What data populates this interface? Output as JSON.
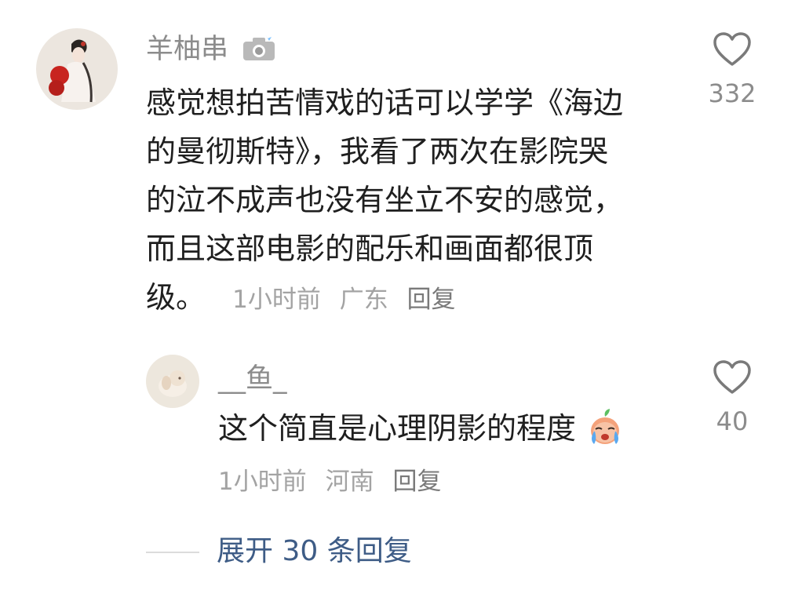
{
  "comments": [
    {
      "username": "羊柚串",
      "badge_icon": "camera-flash-icon",
      "text_lines": [
        "感觉想拍苦情戏的话可以学学《海边",
        "的曼彻斯特》，我看了两次在影院哭",
        "的泣不成声也没有坐立不安的感觉，",
        "而且这部电影的配乐和画面都很顶",
        "级。"
      ],
      "time": "1小时前",
      "location": "广东",
      "reply_label": "回复",
      "likes": "332",
      "like_icon": "heart-outline-icon"
    }
  ],
  "replies": [
    {
      "username": "__鱼_",
      "text": "这个简直是心理阴影的程度",
      "emoji": "crying-peach-emoji-icon",
      "time": "1小时前",
      "location": "河南",
      "reply_label": "回复",
      "likes": "40",
      "like_icon": "heart-outline-icon"
    }
  ],
  "expand": {
    "label": "展开 30 条回复"
  },
  "colors": {
    "username": "#8c8c8c",
    "text": "#1f1f1f",
    "meta": "#a3a3a3",
    "expand_link": "#3e5c86"
  }
}
